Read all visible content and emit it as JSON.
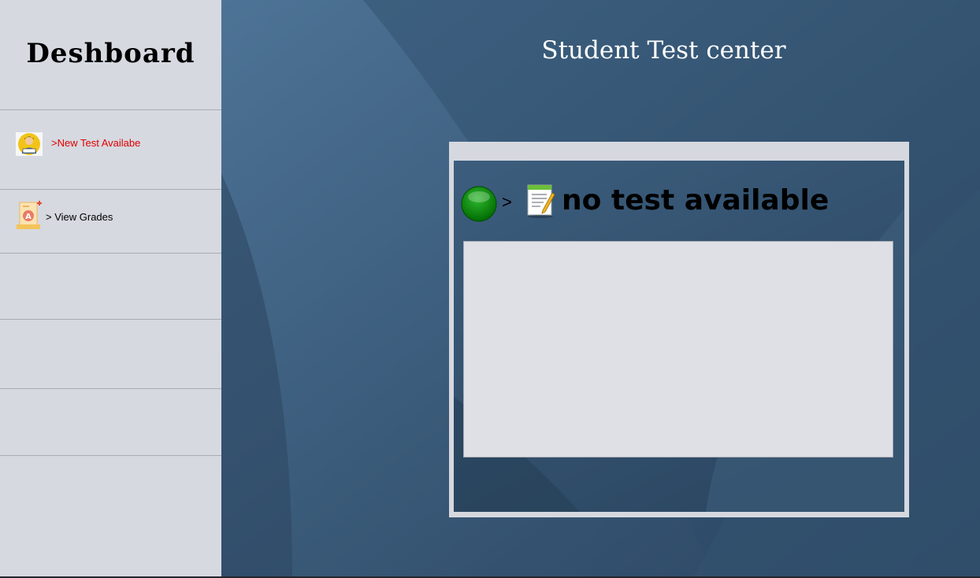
{
  "sidebar": {
    "title": "Deshboard",
    "items": [
      {
        "label": ">New Test Availabe",
        "icon": "student-reading-icon",
        "color": "#e00000"
      },
      {
        "label": "> View Grades",
        "icon": "grade-certificate-icon",
        "color": "#000000"
      }
    ]
  },
  "main": {
    "title": "Student Test center"
  },
  "test_panel": {
    "status_icon": "green-orb-icon",
    "arrow": ">",
    "doc_icon": "document-edit-icon",
    "message": "no test available"
  },
  "colors": {
    "sidebar_bg": "#d6d9e0",
    "main_bg": "#3b5a78",
    "panel_frame": "#d6d8df",
    "list_bg": "#dfe0e5",
    "alert_text": "#e00000"
  }
}
